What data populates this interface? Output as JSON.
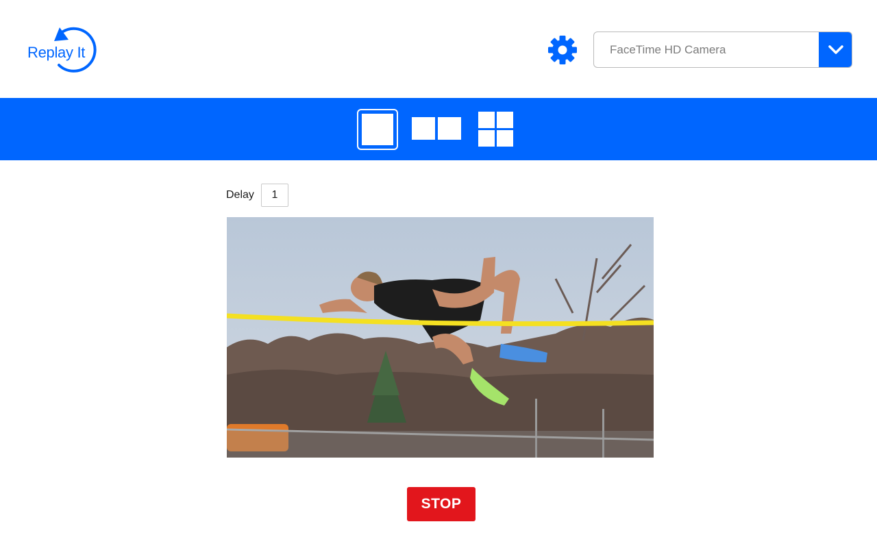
{
  "app": {
    "logo_text": "Replay It"
  },
  "header": {
    "settings_icon": "gear-icon",
    "camera_select": {
      "value": "FaceTime HD Camera",
      "caret_icon": "chevron-down-icon"
    }
  },
  "toolbar": {
    "layouts": [
      {
        "id": "single",
        "icon": "single-view-icon",
        "selected": true
      },
      {
        "id": "split",
        "icon": "split-view-icon",
        "selected": false
      },
      {
        "id": "grid",
        "icon": "grid-view-icon",
        "selected": false
      }
    ]
  },
  "controls": {
    "delay_label": "Delay",
    "delay_value": "1",
    "stop_label": "STOP"
  },
  "colors": {
    "accent": "#0066ff",
    "stop": "#e2161c"
  }
}
